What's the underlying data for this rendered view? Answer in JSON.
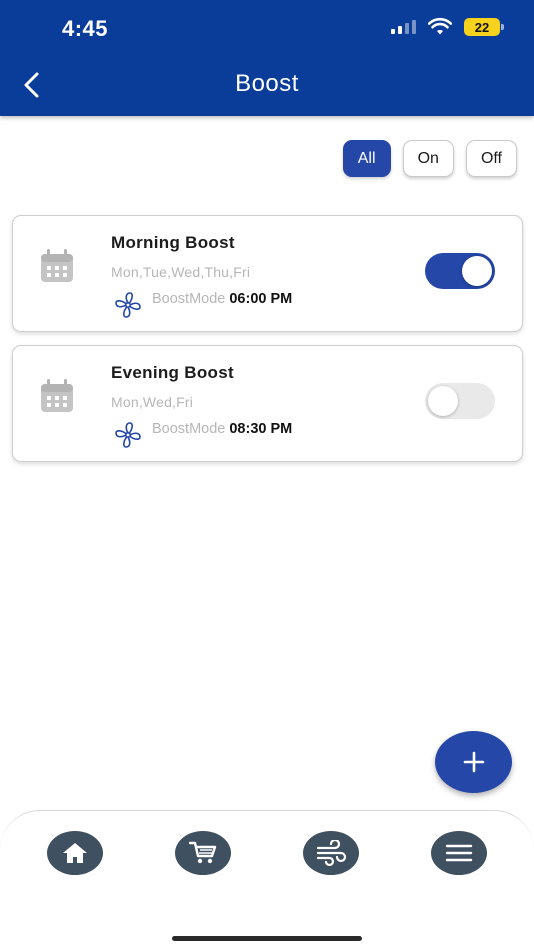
{
  "status_bar": {
    "time": "4:45",
    "battery": "22"
  },
  "header": {
    "title": "Boost"
  },
  "filters": [
    {
      "label": "All",
      "active": true
    },
    {
      "label": "On",
      "active": false
    },
    {
      "label": "Off",
      "active": false
    }
  ],
  "schedules": [
    {
      "name": "Morning Boost",
      "days": "Mon,Tue,Wed,Thu,Fri",
      "mode": "BoostMode",
      "time": "06:00 PM",
      "enabled": true
    },
    {
      "name": "Evening Boost",
      "days": "Mon,Wed,Fri",
      "mode": "BoostMode",
      "time": "08:30 PM",
      "enabled": false
    }
  ],
  "icons": {
    "back": "chevron-left-icon",
    "schedule": "calendar-icon",
    "mode": "fan-icon",
    "add": "plus-icon",
    "nav": [
      "home-icon",
      "cart-icon",
      "wind-icon",
      "menu-icon"
    ]
  },
  "colors": {
    "header": "#0a3d9a",
    "accent": "#2447a8",
    "nav_button": "#3f5060",
    "muted_text": "#b6b6b6"
  }
}
